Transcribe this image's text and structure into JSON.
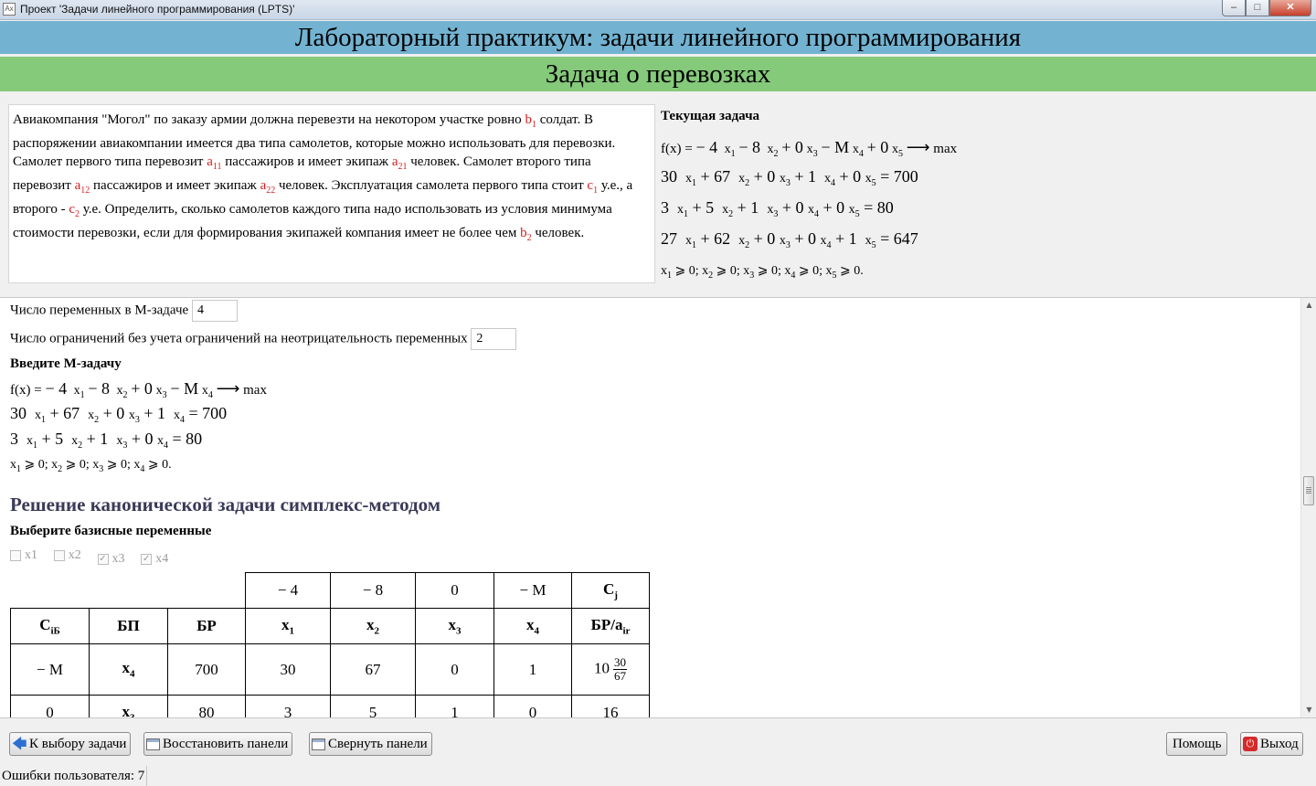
{
  "window": {
    "icon_text": "Ax",
    "title": "Проект 'Задачи линейного программирования (LPTS)'",
    "buttons": {
      "minimize": "–",
      "maximize": "□",
      "close": "✕"
    }
  },
  "header": {
    "title": "Лабораторный практикум: задачи линейного программирования",
    "subtitle": "Задача о перевозках"
  },
  "description": {
    "p1": "Авиакомпания \"Могол\" по заказу армии должна перевезти на некотором участке ровно ",
    "p2": " солдат. В распоряжении авиакомпании имеется два типа самолетов, которые можно использовать для перевозки. Самолет первого типа перевозит ",
    "p3": " пассажиров и имеет экипаж ",
    "p4": " человек. Самолет второго типа перевозит ",
    "p5": " пассажиров и имеет экипаж ",
    "p6": " человек. Эксплуатация самолета первого типа стоит ",
    "p7": " у.е., а второго - ",
    "p8": " у.е. Определить, сколько самолетов каждого типа надо использовать из условия минимума стоимости перевозки, если для формирования экипажей компания имеет не более чем ",
    "p9": " человек.",
    "params": {
      "b1": "b",
      "b1_sub": "1",
      "a11": "a",
      "a11_sub": "11",
      "a21": "a",
      "a21_sub": "21",
      "a12": "a",
      "a12_sub": "12",
      "a22": "a",
      "a22_sub": "22",
      "c1": "c",
      "c1_sub": "1",
      "c2": "c",
      "c2_sub": "2",
      "b2": "b",
      "b2_sub": "2"
    }
  },
  "current_task": {
    "heading": "Текущая задача",
    "objective": {
      "fx": "f(x) =",
      "c1": "− 4",
      "c2": "− 8",
      "c3": "+ 0",
      "c4": "− M",
      "c5": "+ 0",
      "arrow": "⟶",
      "goal": "max"
    },
    "constraints": [
      {
        "k1": "30",
        "k2": "+ 67",
        "k3": "+ 0",
        "k4": "+ 1",
        "k5": "+ 0",
        "rhs": "= 700"
      },
      {
        "k1": "3",
        "k2": "+ 5",
        "k3": "+ 1",
        "k4": "+ 0",
        "k5": "+ 0",
        "rhs": "= 80"
      },
      {
        "k1": "27",
        "k2": "+ 62",
        "k3": "+ 0",
        "k4": "+ 0",
        "k5": "+ 1",
        "rhs": "= 647"
      }
    ],
    "nonneg": "⩾ 0;"
  },
  "var": {
    "x": "x",
    "s1": "1",
    "s2": "2",
    "s3": "3",
    "s4": "4",
    "s5": "5",
    "end": "⩾ 0."
  },
  "mtask": {
    "vars_label": "Число переменных в М-задаче",
    "vars_value": "4",
    "cons_label": "Число ограничений без учета ограничений на неотрицательность переменных",
    "cons_value": "2",
    "enter_heading": "Введите М-задачу",
    "objective": {
      "fx": "f(x) =",
      "c1": "− 4",
      "c2": "− 8",
      "c3": "+ 0",
      "c4": "− M",
      "arrow": "⟶",
      "goal": "max"
    },
    "constraints": [
      {
        "k1": "30",
        "k2": "+ 67",
        "k3": "+ 0",
        "k4": "+ 1",
        "rhs": "= 700"
      },
      {
        "k1": "3",
        "k2": "+ 5",
        "k3": "+ 1",
        "k4": "+ 0",
        "rhs": "= 80"
      }
    ]
  },
  "simplex": {
    "title": "Решение канонической задачи симплекс-методом",
    "basis_heading": "Выберите базисные переменные",
    "checkboxes": [
      {
        "label": "x1",
        "mark": ""
      },
      {
        "label": "x2",
        "mark": ""
      },
      {
        "label": "x3",
        "mark": "✓"
      },
      {
        "label": "x4",
        "mark": "✓"
      }
    ],
    "cj_row": [
      "− 4",
      "− 8",
      "0",
      "− M"
    ],
    "cj_label": "C",
    "cj_sub": "j",
    "head": {
      "cib": "C",
      "cib_sub": "iБ",
      "bp": "БП",
      "br": "БР",
      "ratio": "БР/a",
      "ratio_sub": "ir"
    },
    "rows": [
      {
        "cib": "− M",
        "bp": "x",
        "bp_sub": "4",
        "br": "700",
        "x1": "30",
        "x2": "67",
        "x3": "0",
        "x4": "1",
        "ratio_int": "10",
        "ratio_num": "30",
        "ratio_den": "67"
      },
      {
        "cib": "0",
        "bp": "x",
        "bp_sub": "3",
        "br": "80",
        "x1": "3",
        "x2": "5",
        "x3": "1",
        "x4": "0",
        "ratio_int": "16"
      }
    ]
  },
  "toolbar": {
    "back": "К выбору задачи",
    "restore": "Восстановить панели",
    "collapse": "Свернуть панели",
    "help": "Помощь",
    "exit": "Выход"
  },
  "status": {
    "errors": "Ошибки пользователя: 7"
  }
}
